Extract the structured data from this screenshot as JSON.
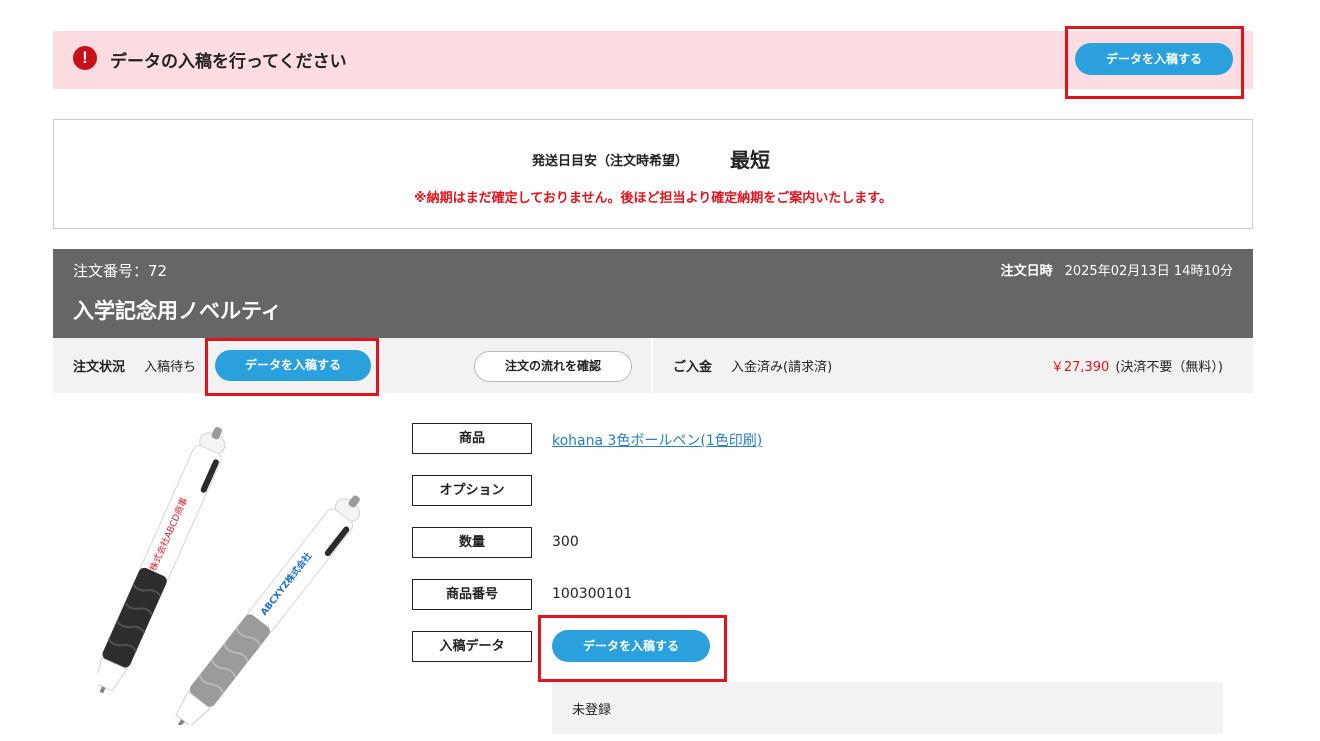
{
  "alert": {
    "icon": "exclamation-icon",
    "message": "データの入稿を行ってください",
    "button_label": "データを入稿する"
  },
  "shipping": {
    "label": "発送日目安（注文時希望）",
    "value": "最短",
    "note": "※納期はまだ確定しておりません。後ほど担当より確定納期をご案内いたします。"
  },
  "order": {
    "number_text": "注文番号：72",
    "date_label": "注文日時",
    "date_value": "2025年02月13日 14時10分",
    "title": "入学記念用ノベルティ"
  },
  "status": {
    "label": "注文状況",
    "value": "入稿待ち",
    "upload_button": "データを入稿する",
    "flow_button": "注文の流れを確認",
    "payment_label": "ご入金",
    "payment_value": "入金済み(請求済)",
    "amount": "￥27,390",
    "amount_note": "(決済不要（無料）)"
  },
  "product": {
    "image_icon": "pen-product-image",
    "rows": [
      {
        "label": "商品",
        "value": "kohana 3色ボールペン(1色印刷)"
      },
      {
        "label": "オプション",
        "value": ""
      },
      {
        "label": "数量",
        "value": "300"
      },
      {
        "label": "商品番号",
        "value": "100300101"
      },
      {
        "label": "入稿データ",
        "value": ""
      }
    ],
    "upload_button": "データを入稿する",
    "upload_status": "未登録",
    "pen1_imprint": "株式会社ABCD商事",
    "pen2_imprint": "ABCXYZ株式会社"
  },
  "colors": {
    "accent_blue": "#2aa1dc",
    "alert_bg": "#fddde1",
    "alert_red": "#c8101c",
    "header_gray": "#666666",
    "price_red": "#e0141e"
  }
}
